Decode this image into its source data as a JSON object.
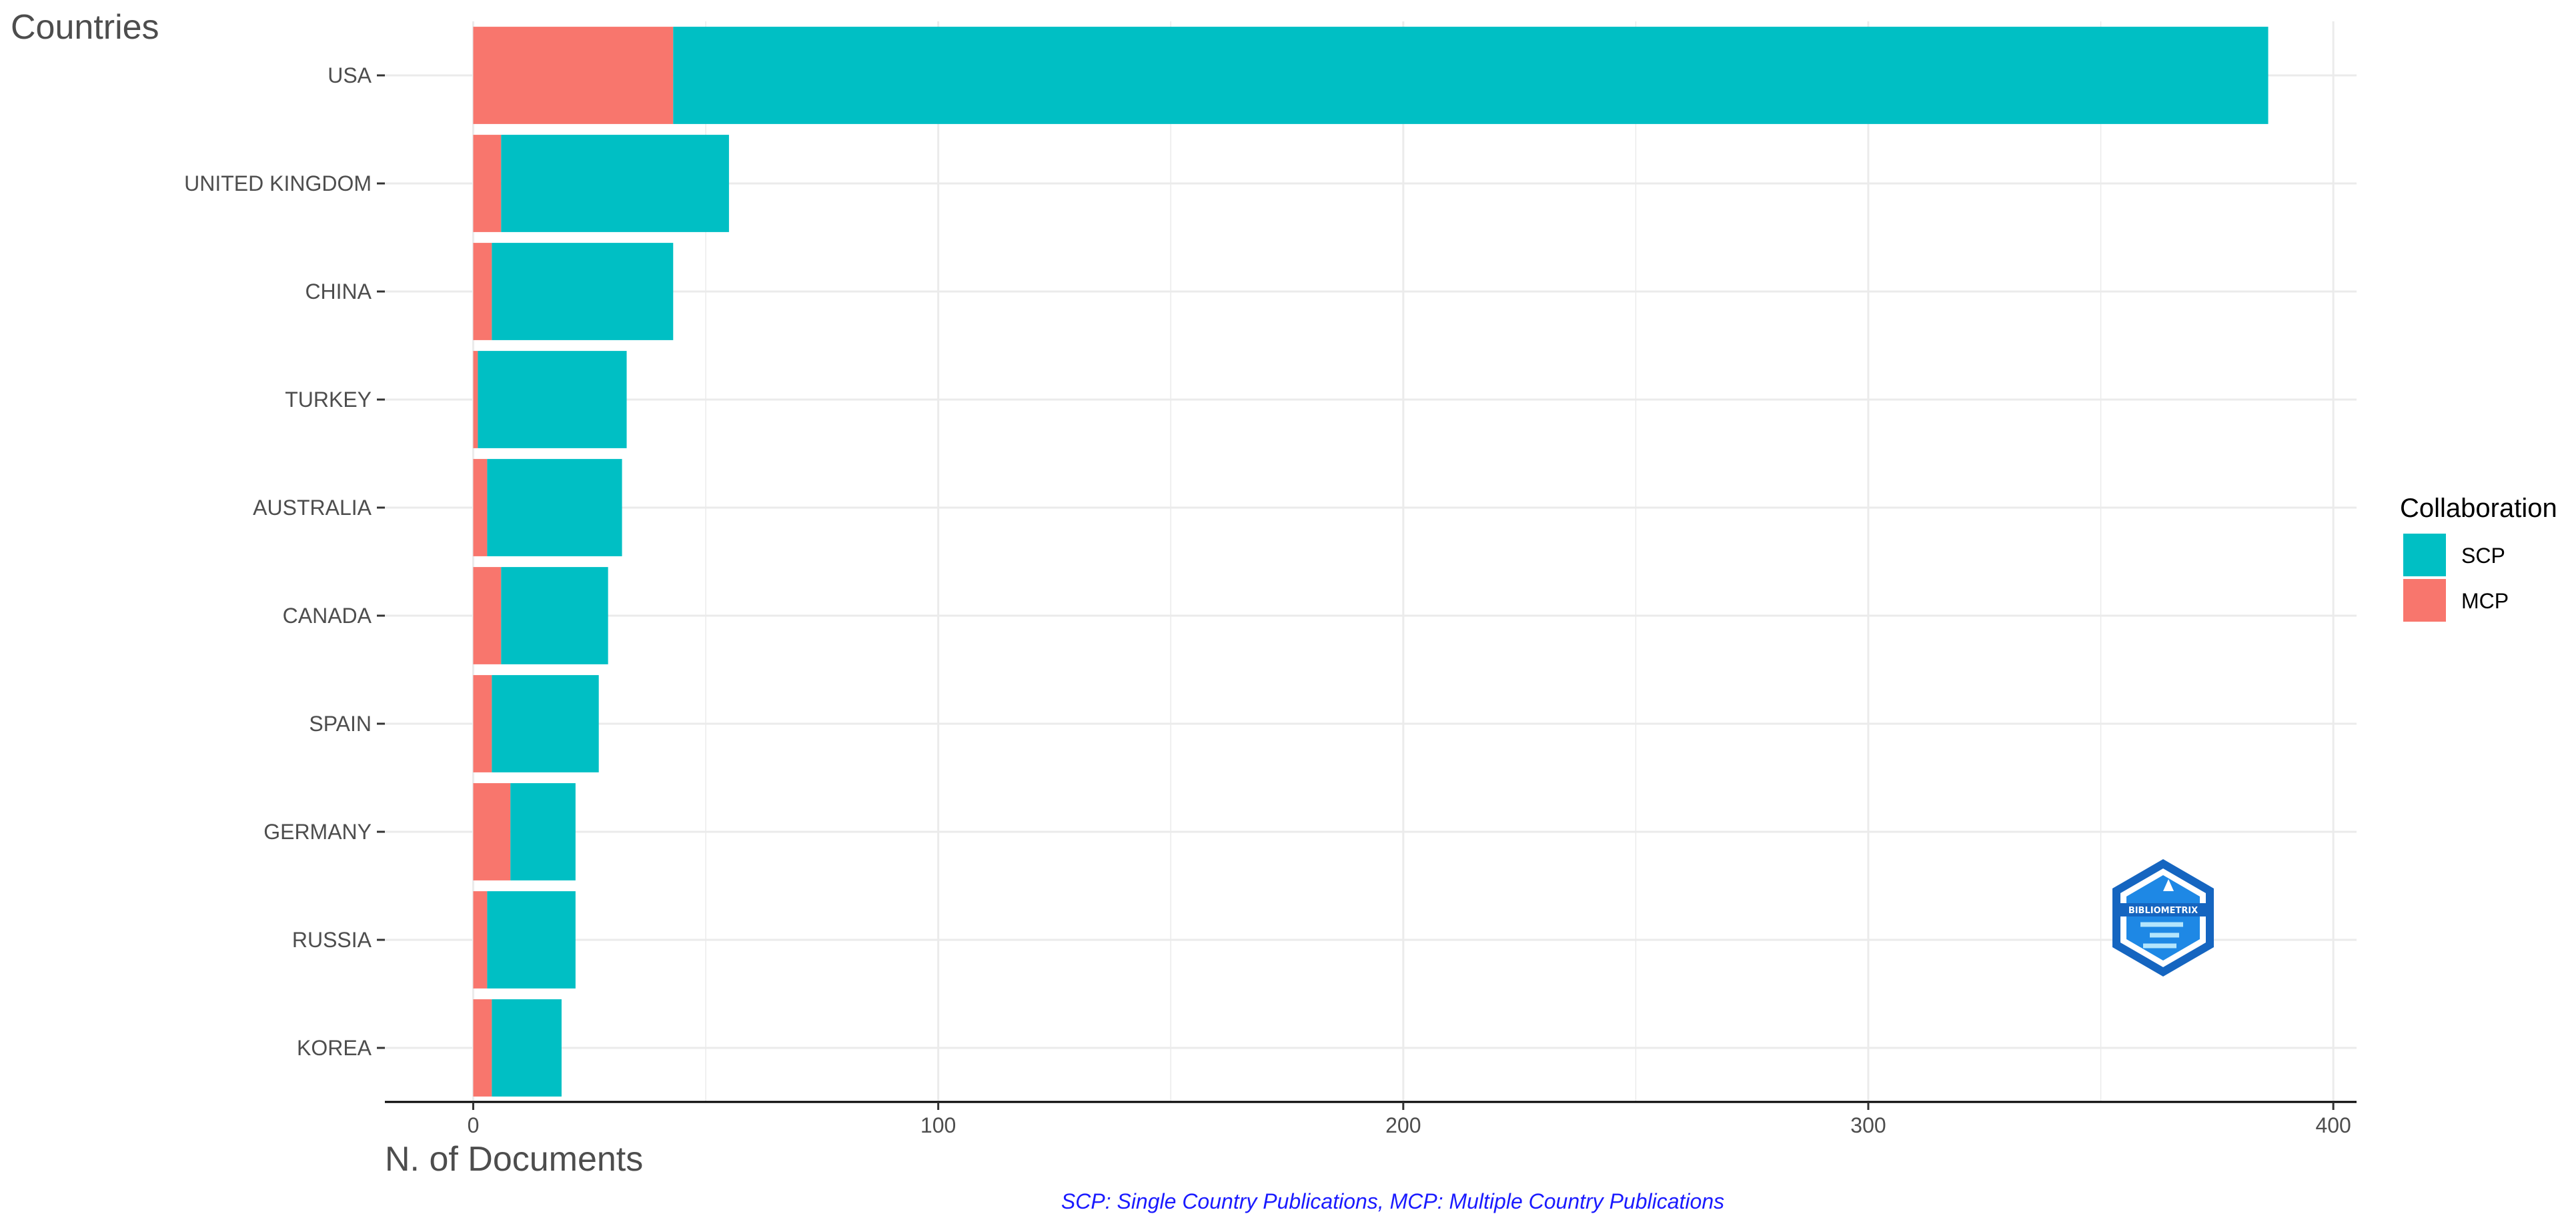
{
  "chart_data": {
    "type": "bar",
    "orientation": "horizontal",
    "stacked": true,
    "categories": [
      "USA",
      "UNITED KINGDOM",
      "CHINA",
      "TURKEY",
      "AUSTRALIA",
      "CANADA",
      "SPAIN",
      "GERMANY",
      "RUSSIA",
      "KOREA"
    ],
    "series": [
      {
        "name": "MCP",
        "color": "#F8766D",
        "values": [
          43,
          6,
          4,
          1,
          3,
          6,
          4,
          8,
          3,
          4
        ]
      },
      {
        "name": "SCP",
        "color": "#00BFC4",
        "values": [
          343,
          49,
          39,
          32,
          29,
          23,
          23,
          14,
          19,
          15
        ]
      }
    ],
    "xlabel": "N. of Documents",
    "ylabel": "Countries",
    "xlim": [
      -19,
      405
    ],
    "xticks": [
      0,
      100,
      200,
      300,
      400
    ],
    "grid": true,
    "legend": {
      "title": "Collaboration",
      "position": "right",
      "entries": [
        {
          "label": "SCP",
          "color": "#00BFC4"
        },
        {
          "label": "MCP",
          "color": "#F8766D"
        }
      ]
    },
    "caption": "SCP: Single Country Publications, MCP: Multiple Country Publications",
    "watermark": {
      "icon": "bibliometrix-logo-icon",
      "text": "BIBLIOMETRIX"
    }
  }
}
